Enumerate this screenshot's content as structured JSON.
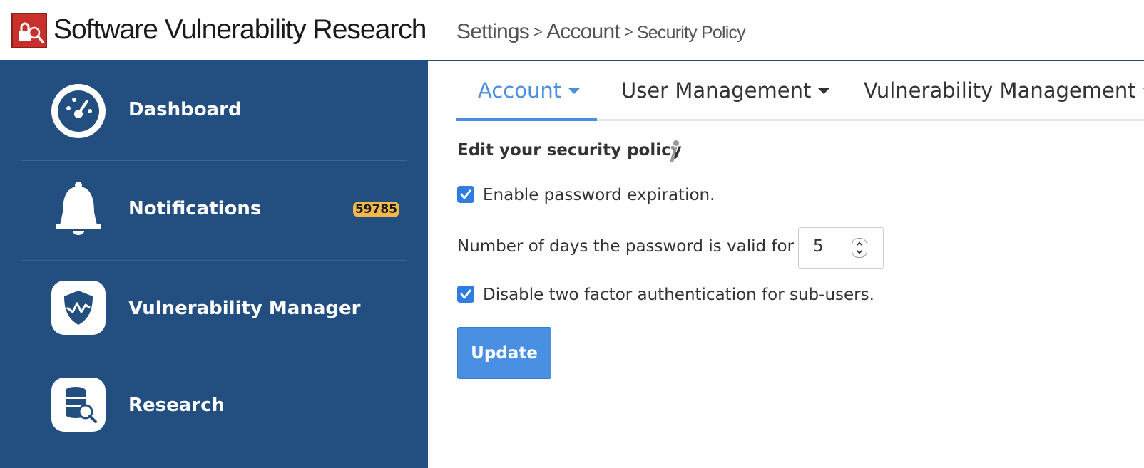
{
  "header": {
    "app_title": "Software Vulnerability Research",
    "logo_icon": "lock-search-icon",
    "brand_color": "#c9302c"
  },
  "breadcrumb": {
    "items": [
      "Settings",
      "Account",
      "Security Policy"
    ],
    "separator": ">"
  },
  "sidebar": {
    "background": "#234f80",
    "items": [
      {
        "label": "Dashboard",
        "icon": "dashboard-gauge-icon"
      },
      {
        "label": "Notifications",
        "icon": "bell-icon",
        "badge": "59785"
      },
      {
        "label": "Vulnerability Manager",
        "icon": "shield-icon"
      },
      {
        "label": "Research",
        "icon": "database-search-icon"
      }
    ]
  },
  "tabs": [
    {
      "label": "Account",
      "active": true
    },
    {
      "label": "User Management",
      "active": false
    },
    {
      "label": "Vulnerability Management",
      "active": false
    }
  ],
  "form": {
    "title": "Edit your security policy",
    "info_icon": "info-icon",
    "password_expiration": {
      "label": "Enable password expiration.",
      "checked": true
    },
    "days_valid": {
      "label": "Number of days the password is valid for",
      "value": "5"
    },
    "disable_2fa": {
      "label": "Disable two factor authentication for sub-users.",
      "checked": true
    },
    "update_label": "Update"
  },
  "colors": {
    "accent": "#4a90e2",
    "checkbox": "#2f7de1",
    "badge": "#f2b84b"
  }
}
